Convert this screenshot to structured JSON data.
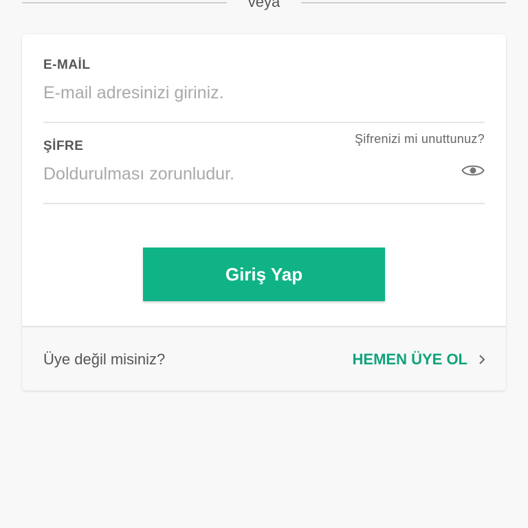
{
  "divider": {
    "text": "veya"
  },
  "form": {
    "email": {
      "label": "E-MAİL",
      "placeholder": "E-mail adresinizi giriniz."
    },
    "password": {
      "label": "ŞİFRE",
      "placeholder": "Doldurulması zorunludur.",
      "forgot_link": "Şifrenizi mi unuttunuz?",
      "visibility_icon": "eye-icon"
    },
    "submit_label": "Giriş Yap"
  },
  "footer": {
    "prompt": "Üye değil misiniz?",
    "signup_label": "HEMEN ÜYE OL",
    "signup_icon": "chevron-right-icon"
  },
  "colors": {
    "accent": "#10b386",
    "accent_text": "#10a37c",
    "background": "#f8f8f8",
    "card": "#ffffff"
  }
}
